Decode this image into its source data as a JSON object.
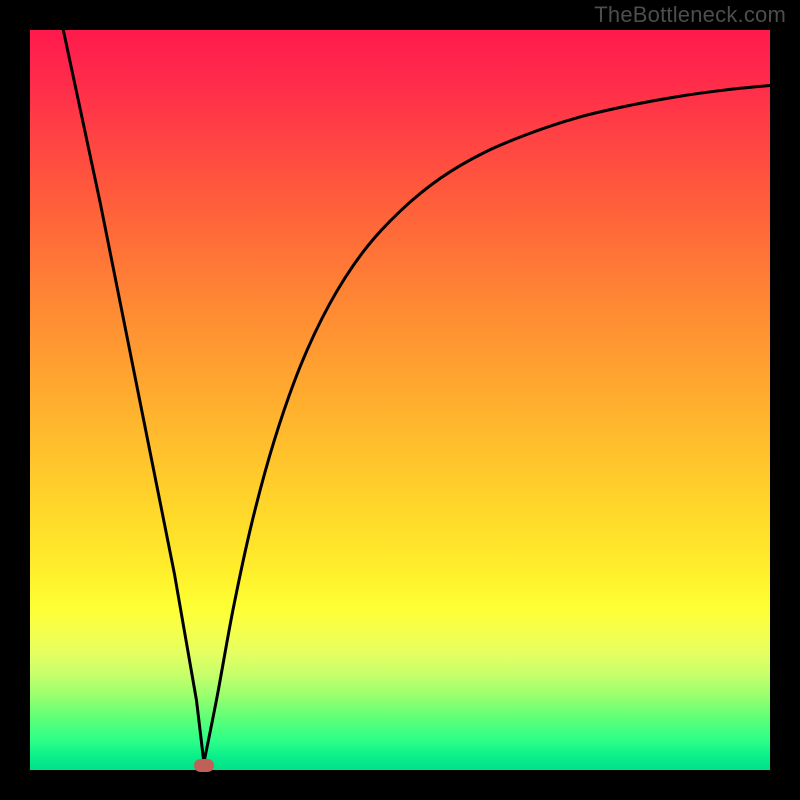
{
  "watermark": "TheBottleneck.com",
  "marker": {
    "color": "#c06058",
    "x_frac": 0.235,
    "y_frac": 0.995
  },
  "chart_data": {
    "type": "line",
    "title": "",
    "xlabel": "",
    "ylabel": "",
    "xlim": [
      0,
      1
    ],
    "ylim": [
      0,
      1
    ],
    "curve_left": {
      "comment": "Steep descending segment from top-left to the valley",
      "points": [
        {
          "x": 0.045,
          "y": 1.0
        },
        {
          "x": 0.07,
          "y": 0.883
        },
        {
          "x": 0.095,
          "y": 0.766
        },
        {
          "x": 0.12,
          "y": 0.641
        },
        {
          "x": 0.145,
          "y": 0.516
        },
        {
          "x": 0.17,
          "y": 0.391
        },
        {
          "x": 0.195,
          "y": 0.266
        },
        {
          "x": 0.21,
          "y": 0.18
        },
        {
          "x": 0.225,
          "y": 0.094
        },
        {
          "x": 0.235,
          "y": 0.01
        }
      ]
    },
    "curve_right": {
      "comment": "Rising segment from the valley, concave, asymptotic toward upper-right",
      "points": [
        {
          "x": 0.235,
          "y": 0.01
        },
        {
          "x": 0.253,
          "y": 0.1
        },
        {
          "x": 0.275,
          "y": 0.22
        },
        {
          "x": 0.3,
          "y": 0.335
        },
        {
          "x": 0.33,
          "y": 0.445
        },
        {
          "x": 0.365,
          "y": 0.545
        },
        {
          "x": 0.405,
          "y": 0.63
        },
        {
          "x": 0.45,
          "y": 0.7
        },
        {
          "x": 0.5,
          "y": 0.755
        },
        {
          "x": 0.555,
          "y": 0.8
        },
        {
          "x": 0.615,
          "y": 0.835
        },
        {
          "x": 0.68,
          "y": 0.862
        },
        {
          "x": 0.745,
          "y": 0.883
        },
        {
          "x": 0.81,
          "y": 0.898
        },
        {
          "x": 0.875,
          "y": 0.91
        },
        {
          "x": 0.94,
          "y": 0.919
        },
        {
          "x": 1.0,
          "y": 0.925
        }
      ]
    },
    "valley": {
      "x": 0.235,
      "y": 0.01
    },
    "annotations": [],
    "grid": false,
    "legend": null
  }
}
